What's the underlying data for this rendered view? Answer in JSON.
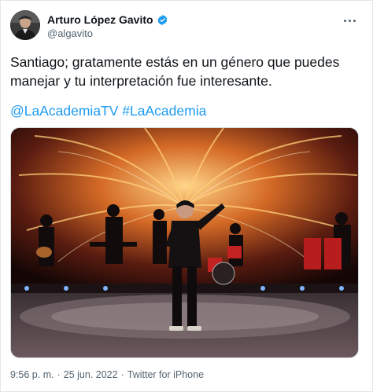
{
  "author": {
    "name": "Arturo López Gavito",
    "handle": "@algavito"
  },
  "icons": {
    "verified": "verified-badge-icon",
    "more": "more-options-icon"
  },
  "colors": {
    "link": "#1d9bf0",
    "secondary_text": "#536471",
    "primary_text": "#0f1419"
  },
  "tweet": {
    "text": "Santiago; gratamente estás en un género que puedes manejar y tu interpretación fue interesante.",
    "hashtags": [
      "@LaAcademiaTV",
      "#LaAcademia"
    ],
    "time": "9:56 p. m.",
    "separator": "·",
    "date": "25 jun. 2022",
    "source": "Twitter for iPhone"
  }
}
